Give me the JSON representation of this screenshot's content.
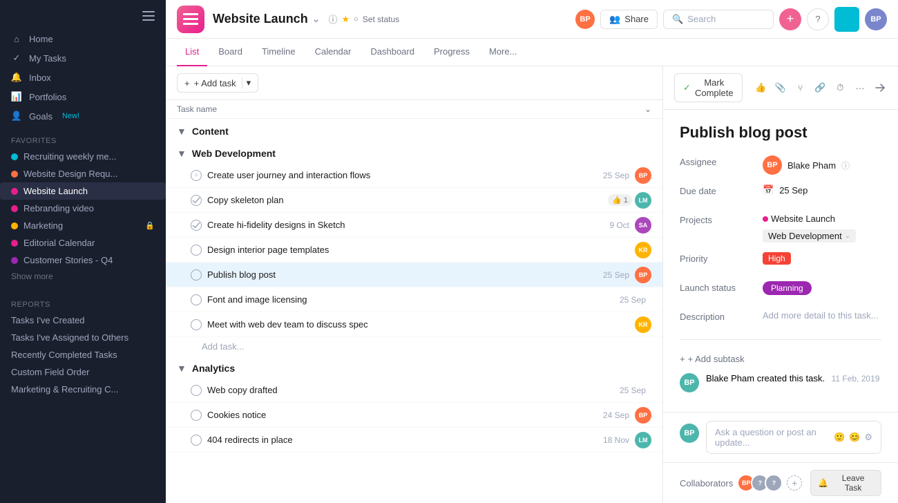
{
  "sidebar": {
    "nav_items": [
      {
        "id": "home",
        "label": "Home",
        "icon": "home"
      },
      {
        "id": "my-tasks",
        "label": "My Tasks",
        "icon": "check-circle"
      },
      {
        "id": "inbox",
        "label": "Inbox",
        "icon": "bell"
      },
      {
        "id": "portfolios",
        "label": "Portfolios",
        "icon": "bar-chart"
      },
      {
        "id": "goals",
        "label": "Goals",
        "icon": "user",
        "badge": "New!"
      }
    ],
    "favorites_label": "Favorites",
    "favorites": [
      {
        "id": "recruiting",
        "label": "Recruiting weekly me...",
        "color": "#00bcd4"
      },
      {
        "id": "website-design",
        "label": "Website Design Requ...",
        "color": "#ff7043"
      },
      {
        "id": "website-launch",
        "label": "Website Launch",
        "color": "#e91e8c",
        "active": true
      },
      {
        "id": "rebranding",
        "label": "Rebranding video",
        "color": "#e91e8c"
      },
      {
        "id": "marketing",
        "label": "Marketing",
        "color": "#ffb300",
        "lock": true
      },
      {
        "id": "editorial",
        "label": "Editorial Calendar",
        "color": "#e91e8c"
      },
      {
        "id": "customer-stories",
        "label": "Customer Stories - Q4",
        "color": "#9c27b0"
      }
    ],
    "show_more_label": "Show more",
    "reports_label": "Reports",
    "reports_items": [
      {
        "id": "tasks-created",
        "label": "Tasks I've Created"
      },
      {
        "id": "tasks-assigned",
        "label": "Tasks I've Assigned to Others"
      },
      {
        "id": "recently-completed",
        "label": "Recently Completed Tasks"
      },
      {
        "id": "custom-field-order",
        "label": "Custom Field Order"
      },
      {
        "id": "marketing-recruiting",
        "label": "Marketing & Recruiting C..."
      }
    ]
  },
  "header": {
    "project_title": "Website Launch",
    "set_status_label": "Set status",
    "share_label": "Share",
    "search_placeholder": "Search",
    "tabs": [
      {
        "id": "list",
        "label": "List",
        "active": true
      },
      {
        "id": "board",
        "label": "Board"
      },
      {
        "id": "timeline",
        "label": "Timeline"
      },
      {
        "id": "calendar",
        "label": "Calendar"
      },
      {
        "id": "dashboard",
        "label": "Dashboard"
      },
      {
        "id": "progress",
        "label": "Progress"
      },
      {
        "id": "more",
        "label": "More..."
      }
    ]
  },
  "task_list": {
    "add_task_label": "+ Add task",
    "task_name_col": "Task name",
    "sections": [
      {
        "id": "content",
        "name": "Content",
        "tasks": []
      },
      {
        "id": "web-development",
        "name": "Web Development",
        "tasks": [
          {
            "id": 1,
            "name": "Create user journey and interaction flows",
            "date": "25 Sep",
            "avatar_color": "#ff7043",
            "avatar_initials": "BP"
          },
          {
            "id": 2,
            "name": "Copy skeleton plan",
            "date": "",
            "avatar_color": "#4db6ac",
            "avatar_initials": "LM",
            "badge": "1"
          },
          {
            "id": 3,
            "name": "Create hi-fidelity designs in Sketch",
            "date": "9 Oct",
            "avatar_color": "#ab47bc",
            "avatar_initials": "SA"
          },
          {
            "id": 4,
            "name": "Design interior page templates",
            "date": "",
            "avatar_color": "#ffb300",
            "avatar_initials": "KR"
          },
          {
            "id": 5,
            "name": "Publish blog post",
            "date": "25 Sep",
            "avatar_color": "#ff7043",
            "avatar_initials": "BP",
            "selected": true
          },
          {
            "id": 6,
            "name": "Font and image licensing",
            "date": "25 Sep",
            "avatar_color": null
          },
          {
            "id": 7,
            "name": "Meet with web dev team to discuss spec",
            "date": "",
            "avatar_color": "#ffb300",
            "avatar_initials": "KR"
          }
        ],
        "add_task_placeholder": "Add task..."
      },
      {
        "id": "analytics",
        "name": "Analytics",
        "tasks": [
          {
            "id": 8,
            "name": "Web copy drafted",
            "date": "25 Sep",
            "avatar_color": null
          },
          {
            "id": 9,
            "name": "Cookies notice",
            "date": "24 Sep",
            "avatar_color": "#ff7043",
            "avatar_initials": "BP"
          },
          {
            "id": 10,
            "name": "404 redirects in place",
            "date": "18 Nov",
            "avatar_color": "#4db6ac",
            "avatar_initials": "LM"
          }
        ]
      }
    ]
  },
  "task_detail": {
    "mark_complete_label": "Mark Complete",
    "title": "Publish blog post",
    "assignee_label": "Assignee",
    "assignee_name": "Blake Pham",
    "due_date_label": "Due date",
    "due_date": "25 Sep",
    "projects_label": "Projects",
    "project_name": "Website Launch",
    "project_tag": "Web Development",
    "priority_label": "Priority",
    "priority_value": "High",
    "launch_status_label": "Launch status",
    "launch_status_value": "Planning",
    "description_label": "Description",
    "description_placeholder": "Add more detail to this task...",
    "add_subtask_label": "+ Add subtask",
    "activity": {
      "creator": "Blake Pham",
      "action": "created this task.",
      "date": "11 Feb, 2019"
    },
    "comment_placeholder": "Ask a question or post an update...",
    "collaborators_label": "Collaborators",
    "leave_task_label": "Leave Task"
  }
}
